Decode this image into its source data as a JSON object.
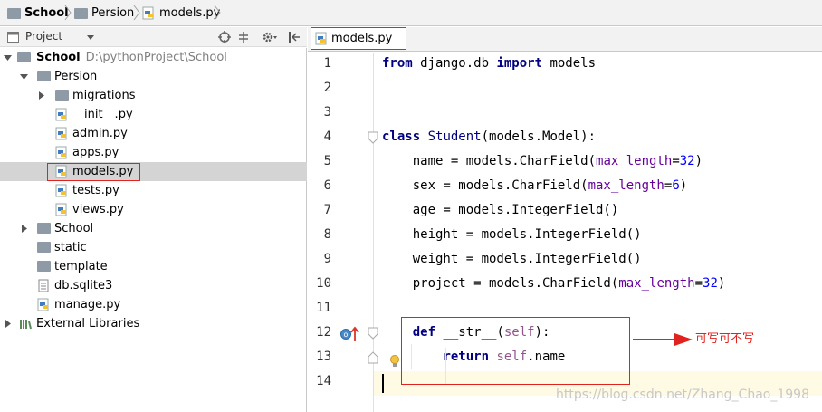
{
  "breadcrumb": {
    "items": [
      {
        "label": "School",
        "icon": "folder-icon"
      },
      {
        "label": "Persion",
        "icon": "folder-icon"
      },
      {
        "label": "models.py",
        "icon": "python-file-icon"
      }
    ]
  },
  "project_panel": {
    "title": "Project",
    "tree": [
      {
        "label": "School",
        "hint": "D:\\pythonProject\\School",
        "icon": "folder-icon",
        "expanded": true
      },
      {
        "label": "Persion",
        "icon": "folder-icon",
        "expanded": true
      },
      {
        "label": "migrations",
        "icon": "folder-icon",
        "expanded": false
      },
      {
        "label": "__init__.py",
        "icon": "python-file-icon"
      },
      {
        "label": "admin.py",
        "icon": "python-file-icon"
      },
      {
        "label": "apps.py",
        "icon": "python-file-icon"
      },
      {
        "label": "models.py",
        "icon": "python-file-icon",
        "selected": true
      },
      {
        "label": "tests.py",
        "icon": "python-file-icon"
      },
      {
        "label": "views.py",
        "icon": "python-file-icon"
      },
      {
        "label": "School",
        "icon": "folder-icon",
        "expanded": false
      },
      {
        "label": "static",
        "icon": "folder-icon"
      },
      {
        "label": "template",
        "icon": "folder-icon"
      },
      {
        "label": "db.sqlite3",
        "icon": "database-file-icon"
      },
      {
        "label": "manage.py",
        "icon": "python-file-icon"
      },
      {
        "label": "External Libraries",
        "icon": "library-icon",
        "expanded": false
      }
    ]
  },
  "editor": {
    "tab_label": "models.py",
    "current_line": 14,
    "line_numbers": [
      "1",
      "2",
      "3",
      "4",
      "5",
      "6",
      "7",
      "8",
      "9",
      "10",
      "11",
      "12",
      "13",
      "14"
    ],
    "lines": [
      [
        {
          "t": "from",
          "c": "kw"
        },
        {
          "t": " django.db ",
          "c": ""
        },
        {
          "t": "import",
          "c": "kw"
        },
        {
          "t": " models",
          "c": ""
        }
      ],
      [],
      [],
      [
        {
          "t": "class",
          "c": "kw"
        },
        {
          "t": " ",
          "c": ""
        },
        {
          "t": "Student",
          "c": "cls"
        },
        {
          "t": "(models.Model):",
          "c": ""
        }
      ],
      [
        {
          "t": "    name = models.CharField(",
          "c": ""
        },
        {
          "t": "max_length",
          "c": "prm"
        },
        {
          "t": "=",
          "c": ""
        },
        {
          "t": "32",
          "c": "num"
        },
        {
          "t": ")",
          "c": ""
        }
      ],
      [
        {
          "t": "    sex = models.CharField(",
          "c": ""
        },
        {
          "t": "max_length",
          "c": "prm"
        },
        {
          "t": "=",
          "c": ""
        },
        {
          "t": "6",
          "c": "num"
        },
        {
          "t": ")",
          "c": ""
        }
      ],
      [
        {
          "t": "    age = models.IntegerField()",
          "c": ""
        }
      ],
      [
        {
          "t": "    height = models.IntegerField()",
          "c": ""
        }
      ],
      [
        {
          "t": "    weight = models.IntegerField()",
          "c": ""
        }
      ],
      [
        {
          "t": "    project = models.CharField(",
          "c": ""
        },
        {
          "t": "max_length",
          "c": "prm"
        },
        {
          "t": "=",
          "c": ""
        },
        {
          "t": "32",
          "c": "num"
        },
        {
          "t": ")",
          "c": ""
        }
      ],
      [],
      [
        {
          "t": "    ",
          "c": ""
        },
        {
          "t": "def",
          "c": "kw"
        },
        {
          "t": " __str__(",
          "c": ""
        },
        {
          "t": "self",
          "c": "slf"
        },
        {
          "t": "):",
          "c": ""
        }
      ],
      [
        {
          "t": "        ",
          "c": ""
        },
        {
          "t": "return",
          "c": "kw"
        },
        {
          "t": " ",
          "c": ""
        },
        {
          "t": "self",
          "c": "slf"
        },
        {
          "t": ".name",
          "c": ""
        }
      ],
      []
    ]
  },
  "annotation": {
    "note": "可写可不写",
    "color": "#e0231f"
  },
  "watermark": "https://blog.csdn.net/Zhang_Chao_1998"
}
